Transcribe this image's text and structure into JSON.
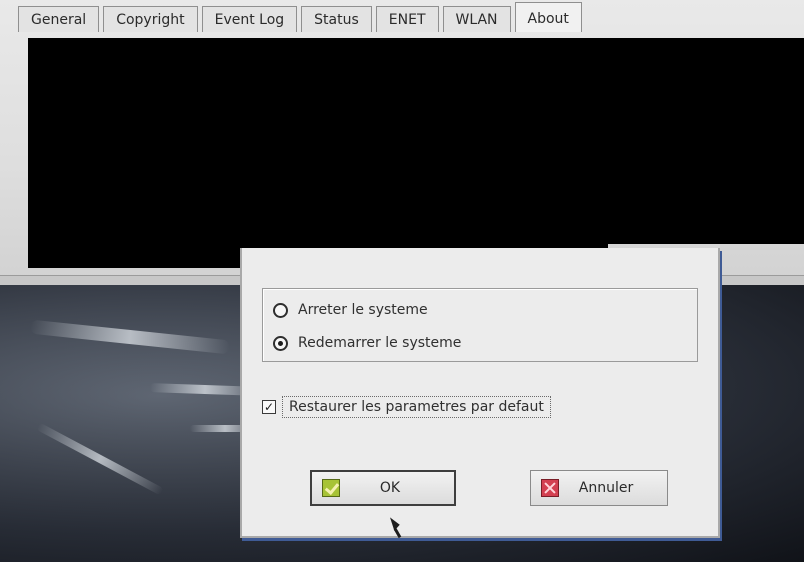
{
  "tabs": [
    {
      "label": "General",
      "selected": false
    },
    {
      "label": "Copyright",
      "selected": false
    },
    {
      "label": "Event Log",
      "selected": false
    },
    {
      "label": "Status",
      "selected": false
    },
    {
      "label": "ENET",
      "selected": false
    },
    {
      "label": "WLAN",
      "selected": false
    },
    {
      "label": "About",
      "selected": true
    }
  ],
  "dialog": {
    "options": [
      {
        "label": "Arreter le systeme",
        "checked": false
      },
      {
        "label": "Redemarrer le systeme",
        "checked": true
      }
    ],
    "restore_label": "Restaurer les parametres par defaut",
    "restore_checked": true,
    "checkbox_mark": "✓",
    "ok_label": "OK",
    "cancel_label": "Annuler",
    "icons": {
      "ok": "check-icon",
      "cancel": "close-icon"
    },
    "colors": {
      "ok_icon": "#a7c336",
      "cancel_icon": "#d34051"
    }
  }
}
